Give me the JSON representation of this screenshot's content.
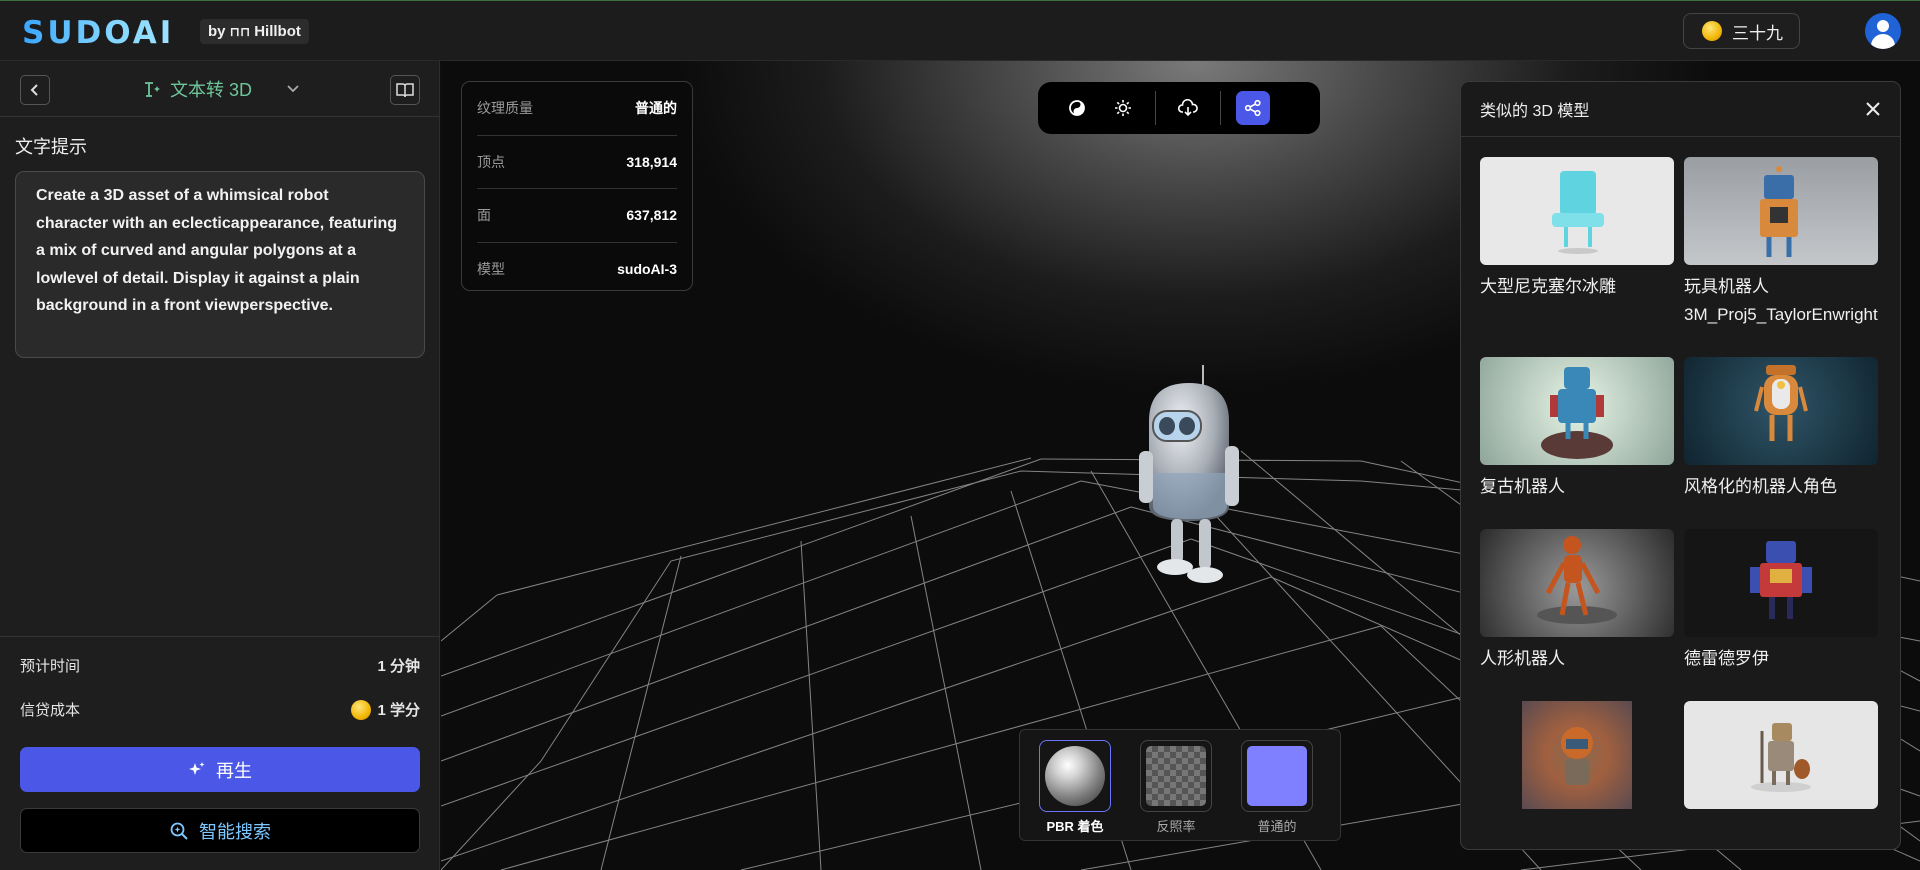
{
  "header": {
    "logo": "SUDOAI",
    "byline_by": "by",
    "byline_brand": "Hillbot",
    "credits": "三十九"
  },
  "left_panel": {
    "mode_label": "文本转 3D",
    "prompt_label": "文字提示",
    "prompt_text": "Create a 3D asset of a whimsical robot character with an eclecticappearance, featuring a mix of curved and angular polygons at a lowlevel of detail. Display it against a plain background in a front viewperspective.",
    "est_time_label": "预计时间",
    "est_time_value": "1 分钟",
    "cost_label": "信贷成本",
    "cost_value": "1 学分",
    "regen_label": "再生",
    "search_label": "智能搜索"
  },
  "stats": [
    {
      "key": "纹理质量",
      "value": "普通的"
    },
    {
      "key": "顶点",
      "value": "318,914"
    },
    {
      "key": "面",
      "value": "637,812"
    },
    {
      "key": "模型",
      "value": "sudoAI-3"
    }
  ],
  "materials": [
    {
      "label": "PBR 着色",
      "selected": true
    },
    {
      "label": "反照率",
      "selected": false
    },
    {
      "label": "普通的",
      "selected": false
    }
  ],
  "similar": {
    "title": "类似的 3D 模型",
    "items": [
      {
        "title": "大型尼克塞尔冰雕"
      },
      {
        "title": "玩具机器人",
        "subtitle": "3M_Proj5_TaylorEnwright"
      },
      {
        "title": "复古机器人"
      },
      {
        "title": "风格化的机器人角色"
      },
      {
        "title": "人形机器人"
      },
      {
        "title": "德雷德罗伊"
      },
      {
        "title": ""
      },
      {
        "title": ""
      }
    ]
  },
  "colors": {
    "accent": "#4b57e6",
    "mode_green": "#6fc59a",
    "search_blue": "#7ec7ff"
  }
}
